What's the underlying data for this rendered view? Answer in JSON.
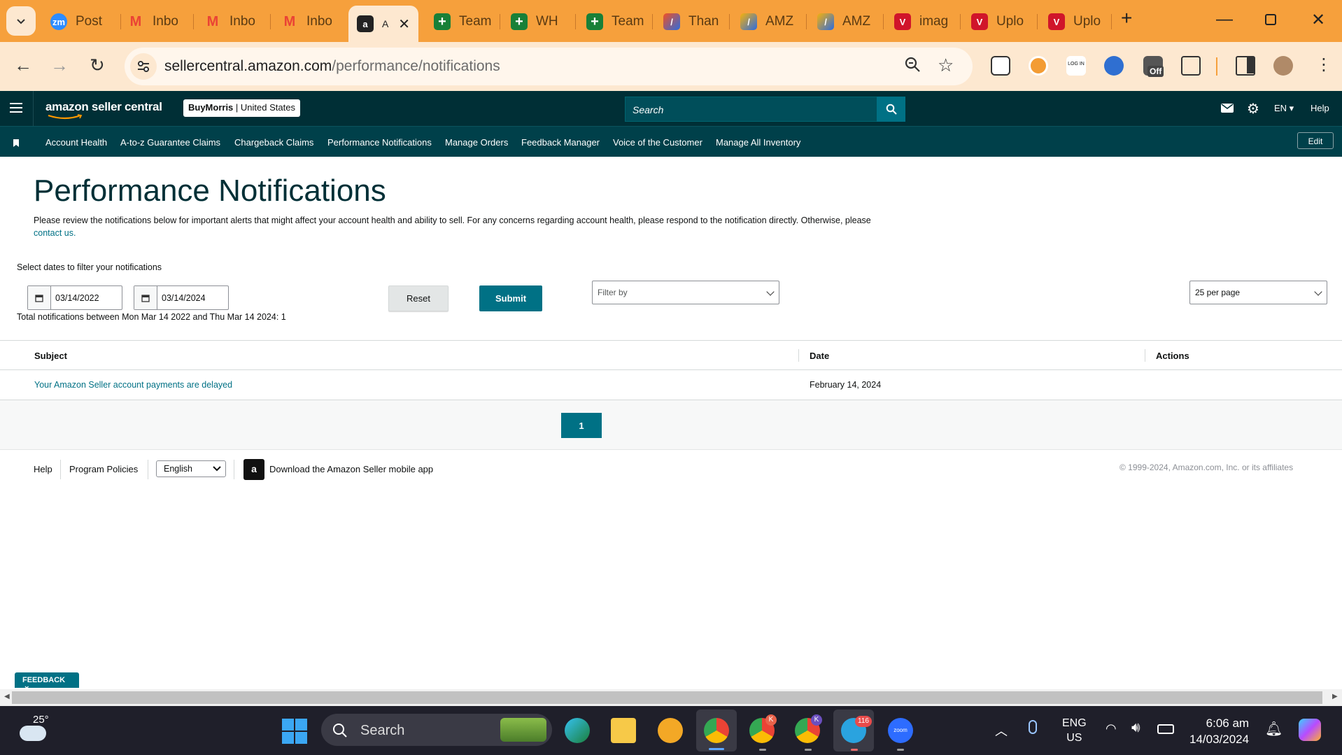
{
  "browser": {
    "tabs": [
      {
        "label": "Post",
        "icon": "zoom-icon",
        "color": "#2d8cff"
      },
      {
        "label": "Inbo",
        "icon": "gmail-icon",
        "color": "#ea4335"
      },
      {
        "label": "Inbo",
        "icon": "gmail-icon",
        "color": "#ea4335"
      },
      {
        "label": "Inbo",
        "icon": "gmail-icon",
        "color": "#ea4335"
      },
      {
        "label": "A",
        "icon": "amazon-icon",
        "color": "#222222"
      },
      {
        "label": "Team",
        "icon": "sheets-plus-icon",
        "color": "#188038"
      },
      {
        "label": "WH",
        "icon": "sheets-plus-icon",
        "color": "#188038"
      },
      {
        "label": "Team",
        "icon": "sheets-plus-icon",
        "color": "#188038"
      },
      {
        "label": "Than",
        "icon": "pen-app-icon",
        "color": "#f25022"
      },
      {
        "label": "AMZ",
        "icon": "pen-app-icon",
        "color": "#2d6cdf"
      },
      {
        "label": "AMZ",
        "icon": "pen-app-icon",
        "color": "#2d6cdf"
      },
      {
        "label": "imag",
        "icon": "shield-v-icon",
        "color": "#d0152a"
      },
      {
        "label": "Uplo",
        "icon": "shield-v-icon",
        "color": "#d0152a"
      },
      {
        "label": "Uplo",
        "icon": "shield-v-icon",
        "color": "#d0152a"
      }
    ],
    "url_host": "sellercentral.amazon.com",
    "url_path": "/performance/notifications",
    "extension_badge": "Off"
  },
  "header": {
    "logo_text": "amazon seller central",
    "store_name": "BuyMorris",
    "store_region": "United States",
    "search_placeholder": "Search",
    "language": "EN",
    "help_label": "Help"
  },
  "nav": {
    "items": [
      "Account Health",
      "A-to-z Guarantee Claims",
      "Chargeback Claims",
      "Performance Notifications",
      "Manage Orders",
      "Feedback Manager",
      "Voice of the Customer",
      "Manage All Inventory"
    ],
    "edit_label": "Edit"
  },
  "main": {
    "title": "Performance Notifications",
    "description": "Please review the notifications below for important alerts that might affect your account health and ability to sell. For any concerns regarding account health, please respond to the notification directly. Otherwise, please",
    "contact_link": "contact us.",
    "date_filter_label": "Select dates to filter your notifications",
    "start_date": "03/14/2022",
    "end_date": "03/14/2024",
    "reset_label": "Reset",
    "submit_label": "Submit",
    "filter_placeholder": "Filter by",
    "per_page": "25 per page",
    "total_text": "Total notifications between Mon Mar 14 2022 and Thu Mar 14 2024: 1"
  },
  "table": {
    "columns": [
      "Subject",
      "Date",
      "Actions"
    ],
    "rows": [
      {
        "subject": "Your Amazon Seller account payments are delayed",
        "date": "February 14, 2024",
        "actions": ""
      }
    ],
    "current_page": "1"
  },
  "footer": {
    "help": "Help",
    "program_policies": "Program Policies",
    "language": "English",
    "app_text": "Download the Amazon Seller mobile app",
    "copyright": "© 1999-2024, Amazon.com, Inc. or its affiliates"
  },
  "feedback_label": "FEEDBACK",
  "taskbar": {
    "weather_temp": "25°",
    "search_label": "Search",
    "telegram_badge": "116",
    "chrome_badge_k": "K",
    "lang_line1": "ENG",
    "lang_line2": "US",
    "time": "6:06 am",
    "date": "14/03/2024"
  },
  "colors": {
    "brand_dark": "#002f36",
    "nav_bg": "#00404a",
    "link": "#007185",
    "tabstrip": "#f6a03c"
  }
}
